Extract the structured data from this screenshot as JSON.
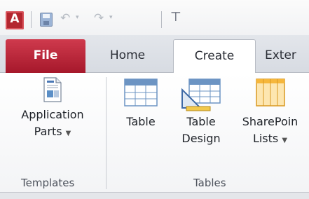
{
  "app": {
    "icon_letter": "A"
  },
  "qat": {
    "undo_glyph": "↶",
    "redo_glyph": "↷",
    "dropdown_glyph": "▾",
    "customize_glyph": "⊤"
  },
  "tabs": [
    {
      "label": "File"
    },
    {
      "label": "Home"
    },
    {
      "label": "Create"
    },
    {
      "label": "Exter"
    }
  ],
  "ribbon": {
    "groups": [
      {
        "label": "Templates",
        "commands": [
          {
            "line1": "Application",
            "line2": "Parts",
            "icon": "application-parts-icon"
          }
        ]
      },
      {
        "label": "Tables",
        "commands": [
          {
            "line1": "Table",
            "icon": "table-icon"
          },
          {
            "line1": "Table",
            "line2": "Design",
            "icon": "table-design-icon"
          },
          {
            "line1": "SharePoin",
            "line2": "Lists",
            "icon": "sharepoint-lists-icon"
          }
        ]
      }
    ]
  },
  "colors": {
    "file_tab": "#b8233a",
    "accent_orange": "#f6b73c",
    "table_blue": "#5b8fc7"
  }
}
